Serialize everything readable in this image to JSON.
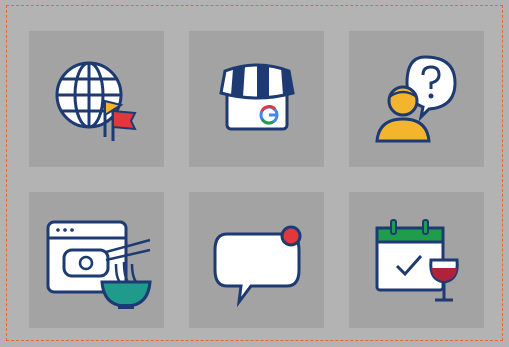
{
  "tiles": [
    {
      "icon": "globe-with-flags-icon"
    },
    {
      "icon": "google-storefront-icon"
    },
    {
      "icon": "person-with-question-icon"
    },
    {
      "icon": "browser-email-noodles-icon"
    },
    {
      "icon": "chat-notification-icon"
    },
    {
      "icon": "calendar-wine-icon"
    }
  ],
  "colors": {
    "page_bg": "#b3b3b3",
    "tile_bg": "#a3a3a3",
    "frame_border": "#e8682f",
    "navy": "#1d3a73",
    "yellow": "#f4b52e",
    "red": "#e2373c",
    "teal": "#1f9a8b",
    "green": "#1f9d4a",
    "wine": "#b0213a"
  }
}
